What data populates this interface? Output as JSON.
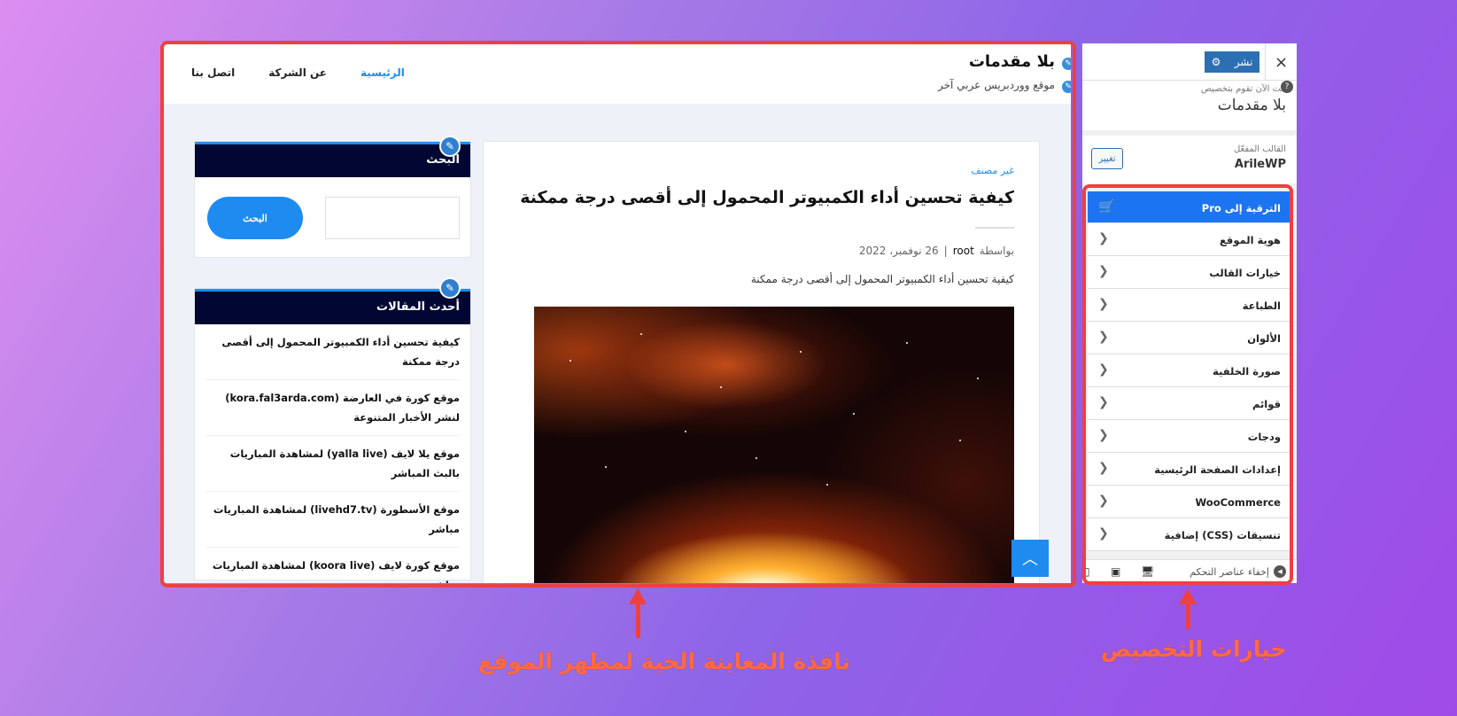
{
  "preview": {
    "site_title": "بلا مقدمات",
    "tagline": "موقع ووردبريس عربي آخر",
    "nav": [
      "الرئيسية",
      "عن الشركة",
      "اتصل بنا"
    ],
    "post": {
      "category": "غير مصنف",
      "title": "كيفية تحسين أداء الكمبيوتر المحمول إلى أقصى درجة ممكنة",
      "by": "بواسطة",
      "author": "root",
      "date": "26 نوفمبر، 2022",
      "sep": "|",
      "excerpt": "كيفية تحسين أداء الكمبيوتر المحمول إلى أقصى درجة ممكنة"
    },
    "search_widget": {
      "title": "البحث",
      "button": "البحث",
      "placeholder": ""
    },
    "recent_widget": {
      "title": "أحدث المقالات",
      "items": [
        "كيفية تحسين أداء الكمبيوتر المحمول إلى أقصى درجة ممكنة",
        "موقع كورة في العارضة (kora.fal3arda.com) لنشر الأخبار المتنوعة",
        "موقع يلا لايف (yalla live) لمشاهدة المباريات بالبث المباشر",
        "موقع الأسطورة (livehd7.tv) لمشاهدة المباريات مباشر",
        "موقع كورة لايف (koora live) لمشاهدة المباريات مباشر"
      ]
    }
  },
  "customizer": {
    "close": "×",
    "publish": "نشر",
    "info_small": "أنت الآن تقوم بتخصيص",
    "info_title": "بلا مقدمات",
    "help": "?",
    "theme_label": "القالب المفعّل",
    "theme_name": "ArileWP",
    "change": "تغيير",
    "menu": [
      "الترقية إلى Pro",
      "هوية الموقع",
      "خيارات القالب",
      "الطباعة",
      "الألوان",
      "صورة الخلفية",
      "قوائم",
      "ودجات",
      "إعدادات الصفحة الرئيسية",
      "WooCommerce",
      "تنسيقات (CSS) إضافية"
    ],
    "hide_controls": "إخفاء عناصر التحكم"
  },
  "annotations": {
    "preview_caption": "نافذة المعاينة الحية لمظهر الموقع",
    "customizer_caption": "خيارات التخصيص",
    "color": "#ef4040"
  },
  "icons": {
    "edit": "pencil-icon",
    "cart": "cart-icon",
    "chevron": "chevron-left-icon",
    "gear": "gear-icon",
    "scroll_top": "chevron-up-icon"
  }
}
